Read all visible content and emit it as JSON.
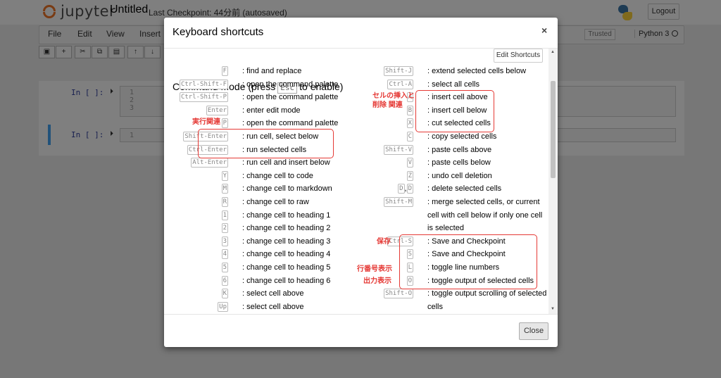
{
  "header": {
    "logo_text": "jupyter",
    "notebook_name": "Untitled",
    "checkpoint": "Last Checkpoint: 44分前  (autosaved)",
    "logout_label": "Logout"
  },
  "menubar": {
    "items": [
      "File",
      "Edit",
      "View",
      "Insert"
    ],
    "trusted": "Trusted",
    "kernel": "Python 3"
  },
  "toolbar": {
    "buttons": [
      {
        "icon": "save-icon",
        "glyph": "▣"
      },
      {
        "icon": "plus-icon",
        "glyph": "+"
      },
      {
        "icon": "cut-icon",
        "glyph": "✂"
      },
      {
        "icon": "copy-icon",
        "glyph": "⧉"
      },
      {
        "icon": "paste-icon",
        "glyph": "▤"
      },
      {
        "icon": "arrow-up-icon",
        "glyph": "↑"
      },
      {
        "icon": "arrow-down-icon",
        "glyph": "↓"
      }
    ]
  },
  "cells": [
    {
      "prompt": "In [ ]:",
      "line_numbers": "1\n2\n3"
    },
    {
      "prompt": "In [ ]:",
      "line_numbers": "1"
    }
  ],
  "modal": {
    "title": "Keyboard shortcuts",
    "close_symbol": "×",
    "section_title_pre": "Command Mode (press",
    "section_title_key": "Esc",
    "section_title_post": "to enable)",
    "edit_shortcuts_label": "Edit Shortcuts",
    "close_button_label": "Close",
    "left_shortcuts": [
      {
        "keys": [
          "F"
        ],
        "desc": ": find and replace"
      },
      {
        "keys": [
          "Ctrl-Shift-F"
        ],
        "desc": ": open the command palette"
      },
      {
        "keys": [
          "Ctrl-Shift-P"
        ],
        "desc": ": open the command palette"
      },
      {
        "keys": [
          "Enter"
        ],
        "desc": ": enter edit mode"
      },
      {
        "keys": [
          "P"
        ],
        "desc": ": open the command palette"
      },
      {
        "keys": [
          "Shift-Enter"
        ],
        "desc": ": run cell, select below"
      },
      {
        "keys": [
          "Ctrl-Enter"
        ],
        "desc": ": run selected cells"
      },
      {
        "keys": [
          "Alt-Enter"
        ],
        "desc": ": run cell and insert below"
      },
      {
        "keys": [
          "Y"
        ],
        "desc": ": change cell to code"
      },
      {
        "keys": [
          "M"
        ],
        "desc": ": change cell to markdown"
      },
      {
        "keys": [
          "R"
        ],
        "desc": ": change cell to raw"
      },
      {
        "keys": [
          "1"
        ],
        "desc": ": change cell to heading 1"
      },
      {
        "keys": [
          "2"
        ],
        "desc": ": change cell to heading 2"
      },
      {
        "keys": [
          "3"
        ],
        "desc": ": change cell to heading 3"
      },
      {
        "keys": [
          "4"
        ],
        "desc": ": change cell to heading 4"
      },
      {
        "keys": [
          "5"
        ],
        "desc": ": change cell to heading 5"
      },
      {
        "keys": [
          "6"
        ],
        "desc": ": change cell to heading 6"
      },
      {
        "keys": [
          "K"
        ],
        "desc": ": select cell above"
      },
      {
        "keys": [
          "Up"
        ],
        "desc": ": select cell above"
      }
    ],
    "right_shortcuts": [
      {
        "keys": [
          "Shift-J"
        ],
        "desc": ": extend selected cells below"
      },
      {
        "keys": [
          "Ctrl-A"
        ],
        "desc": ": select all cells"
      },
      {
        "keys": [
          "A"
        ],
        "desc": ": insert cell above"
      },
      {
        "keys": [
          "B"
        ],
        "desc": ": insert cell below"
      },
      {
        "keys": [
          "X"
        ],
        "desc": ": cut selected cells"
      },
      {
        "keys": [
          "C"
        ],
        "desc": ": copy selected cells"
      },
      {
        "keys": [
          "Shift-V"
        ],
        "desc": ": paste cells above"
      },
      {
        "keys": [
          "V"
        ],
        "desc": ": paste cells below"
      },
      {
        "keys": [
          "Z"
        ],
        "desc": ": undo cell deletion"
      },
      {
        "keys": [
          "D",
          "D"
        ],
        "desc": ": delete selected cells"
      },
      {
        "keys": [
          "Shift-M"
        ],
        "desc": ": merge selected cells, or current"
      },
      {
        "keys": [],
        "desc": "cell with cell below if only one cell"
      },
      {
        "keys": [],
        "desc": "is selected"
      },
      {
        "keys": [
          "Ctrl-S"
        ],
        "desc": ": Save and Checkpoint"
      },
      {
        "keys": [
          "S"
        ],
        "desc": ": Save and Checkpoint"
      },
      {
        "keys": [
          "L"
        ],
        "desc": ": toggle line numbers"
      },
      {
        "keys": [
          "O"
        ],
        "desc": ": toggle output of selected cells"
      },
      {
        "keys": [
          "Shift-O"
        ],
        "desc": ": toggle output scrolling of selected"
      },
      {
        "keys": [],
        "desc": "cells"
      }
    ],
    "annotations": {
      "run_related": "実行関連",
      "insert_delete_line1": "セルの挿入と",
      "insert_delete_line2": "削除 関連",
      "save": "保存",
      "line_numbers": "行番号表示",
      "output": "出力表示"
    },
    "annotation_color": "#e53935"
  }
}
